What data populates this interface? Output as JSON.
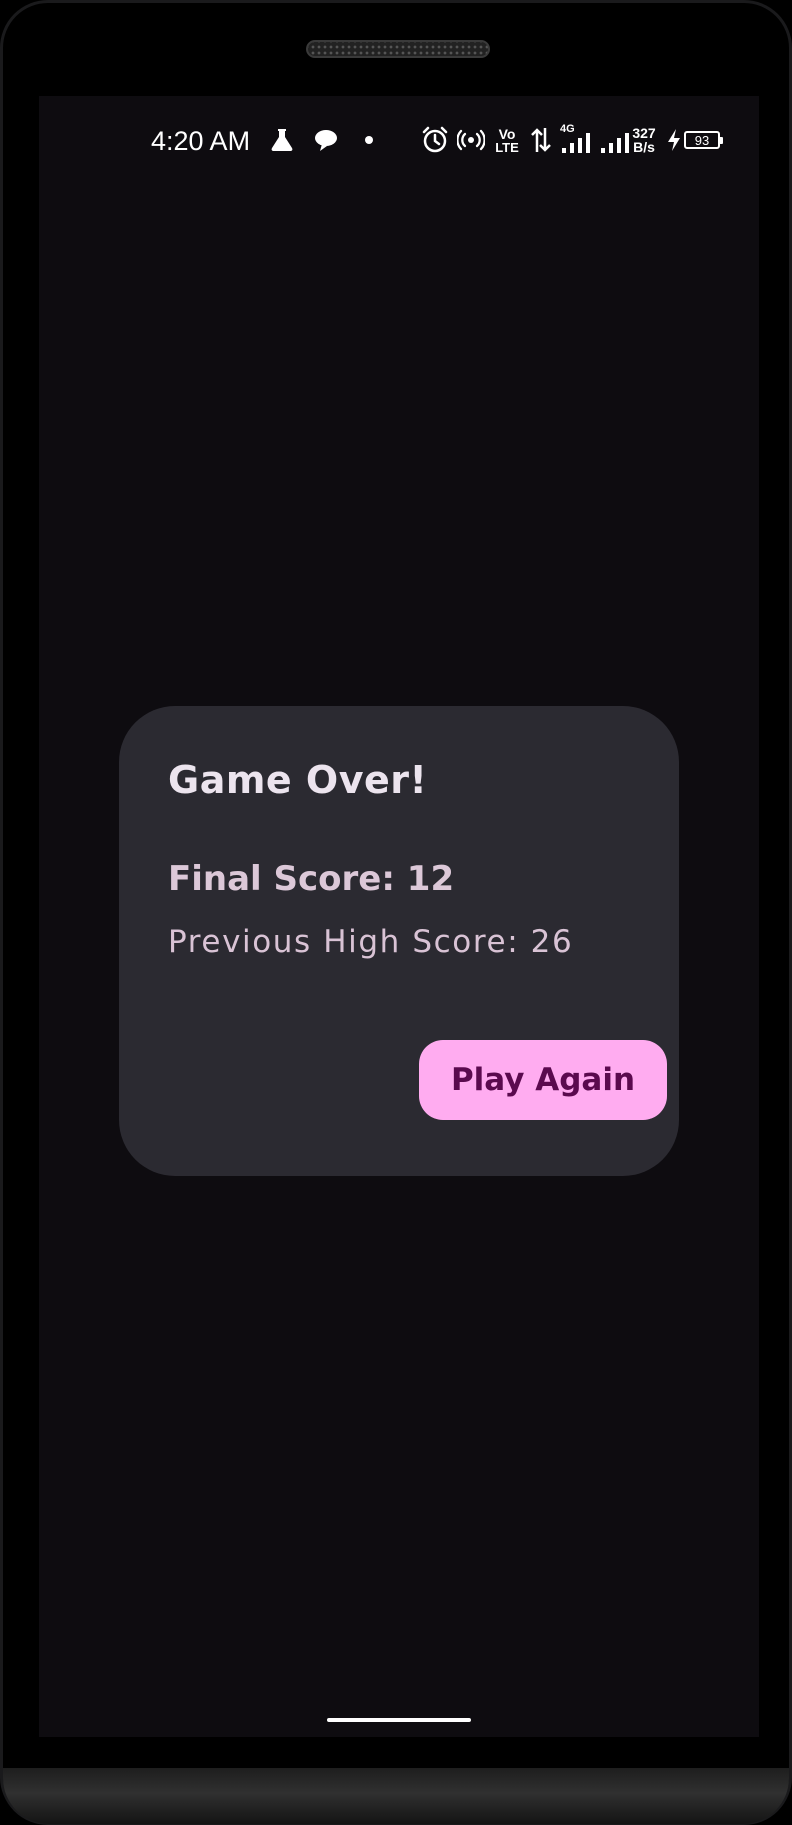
{
  "status_bar": {
    "time": "4:20 AM",
    "volte_top": "Vo",
    "volte_bottom": "LTE",
    "network_type": "4G",
    "speed_value": "327",
    "speed_unit": "B/s",
    "battery_level": "93",
    "icons": [
      "flask-icon",
      "chat-bubble-icon",
      "dot-icon",
      "alarm-icon",
      "hotspot-icon",
      "volte-icon",
      "data-arrows-icon",
      "signal-icon",
      "signal-icon",
      "charging-icon",
      "battery-icon"
    ]
  },
  "dialog": {
    "title": "Game Over!",
    "final_score": "Final Score: 12",
    "high_score": "Previous High Score: 26",
    "button_label": "Play Again"
  },
  "colors": {
    "screen_bg": "#0e0c10",
    "dialog_bg": "#2b2a31",
    "button_bg": "#ffacf0",
    "button_text": "#5a0a4e"
  }
}
